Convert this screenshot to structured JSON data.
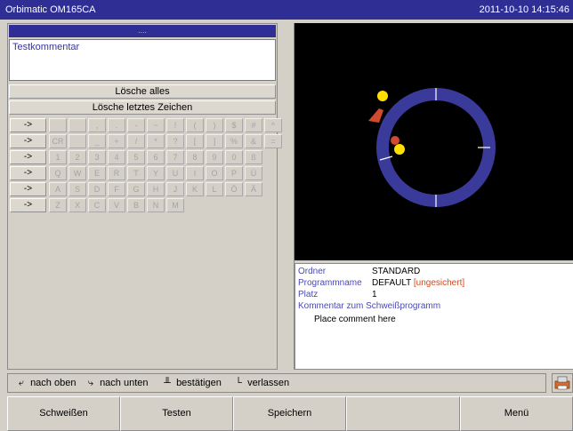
{
  "titlebar": {
    "app_title": "Orbimatic OM165CA",
    "datetime": "2011-10-10 14:15:46"
  },
  "editor": {
    "header": "....",
    "comment_text": "Testkommentar",
    "clear_all_label": "Lösche alles",
    "delete_last_label": "Lösche letztes Zeichen"
  },
  "keyboard": {
    "arrow_label": "->",
    "rows": [
      [
        "",
        "",
        ",",
        ".",
        "-",
        "~",
        "!",
        "(",
        ")",
        "$",
        "#",
        "^"
      ],
      [
        "CR",
        "",
        "_",
        "+",
        "/",
        "*",
        "?",
        "[",
        "]",
        "%",
        "&",
        "="
      ],
      [
        "1",
        "2",
        "3",
        "4",
        "5",
        "6",
        "7",
        "8",
        "9",
        "0",
        "ß"
      ],
      [
        "Q",
        "W",
        "E",
        "R",
        "T",
        "Y",
        "U",
        "I",
        "O",
        "P",
        "Ü"
      ],
      [
        "A",
        "S",
        "D",
        "F",
        "G",
        "H",
        "J",
        "K",
        "L",
        "Ö",
        "Ä"
      ],
      [
        "Z",
        "X",
        "C",
        "V",
        "B",
        "N",
        "M"
      ]
    ]
  },
  "info": {
    "folder_label": "Ordner",
    "folder_value": "STANDARD",
    "program_label": "Programmname",
    "program_value": "DEFAULT",
    "program_flag": "[ungesichert]",
    "slot_label": "Platz",
    "slot_value": "1",
    "comment_label": "Kommentar zum Schweißprogramm",
    "comment_value": "Place comment here"
  },
  "hints": {
    "up": "nach oben",
    "down": "nach unten",
    "confirm": "bestätigen",
    "leave": "verlassen"
  },
  "softkeys": {
    "weld": "Schweißen",
    "test": "Testen",
    "save": "Speichern",
    "empty": "",
    "menu": "Menü"
  },
  "colors": {
    "titlebar": "#2e2e94",
    "ring": "#3a3a9a",
    "electrode": "#ffe000",
    "marker": "#d04a30"
  },
  "icons": {
    "printer": "printer-icon",
    "up": "arrow-up-icon",
    "down": "arrow-down-icon",
    "confirm": "confirm-icon",
    "leave": "leave-icon"
  }
}
